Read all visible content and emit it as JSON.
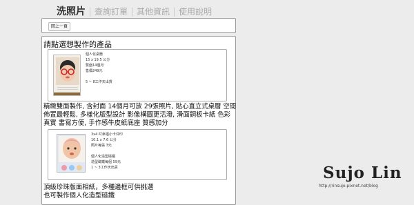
{
  "nav": {
    "items": [
      "洗照片",
      "查詢訂單",
      "其他資訊",
      "使用說明"
    ]
  },
  "toolbar": {
    "prev_label": "回上一頁"
  },
  "main": {
    "heading": "請點選想製作的產品",
    "products": [
      {
        "lines": [
          "個人化桌曆",
          "15 x 19.5 公分",
          "雙面14個月",
          "售價249元",
          "",
          "5 ~ 8工作天出貨"
        ],
        "description": "精緻雙面製作, 含封面 14個月可放 29張照片, 貼心直立式桌曆 空間佈置最輕鬆, 多樣化版型設計 影像構圖更活潑, 滑面銅板卡紙 色彩真實 書寫方便, 手作感牛皮紙底座 質感加分"
      },
      {
        "lines": [
          "3x4 吋幸福小卡沖印",
          "10.1 x 7.6 公分",
          "照片每張 3元",
          "",
          "個人化造型磁鐵",
          "造型磁鐵每個 59元",
          "1 ~ 3工作天出貨"
        ],
        "description_lines": [
          "頂級珍珠版面相紙，多種邊框可供挑選",
          "也可製作個人化造型磁鐵"
        ]
      }
    ]
  },
  "watermark": {
    "name": "Sujo Lin",
    "url": "http://rinsujo.pixnet.net/blog"
  },
  "colors": {
    "background": "#ececec",
    "card": "#ffffff",
    "nav_active": "#333333",
    "nav_inactive": "#aaaaaa"
  }
}
